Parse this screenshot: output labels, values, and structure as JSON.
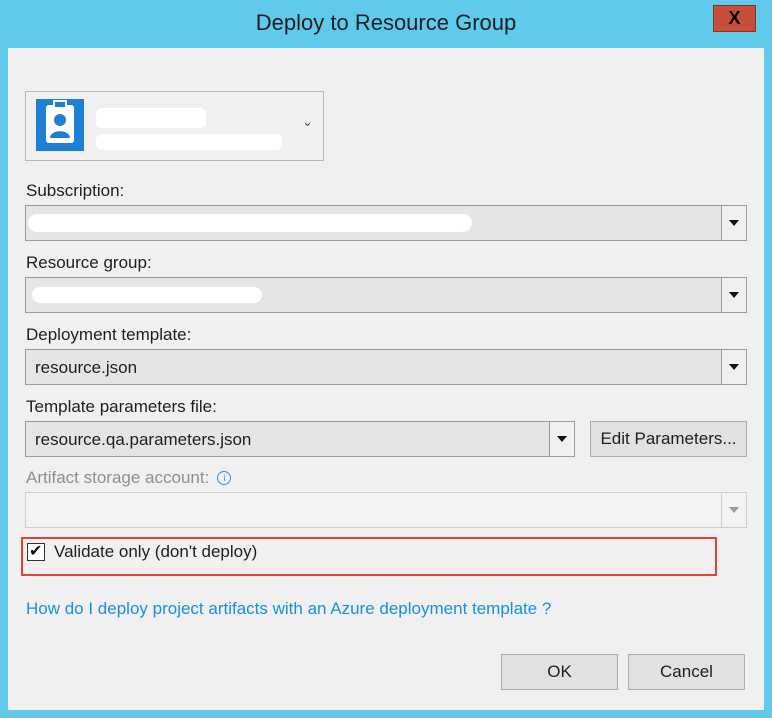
{
  "window": {
    "title": "Deploy to Resource Group",
    "close_glyph": "X"
  },
  "account": {
    "icon": "user-badge-icon"
  },
  "subscription": {
    "label": "Subscription:",
    "value": ""
  },
  "resource_group": {
    "label": "Resource group:",
    "value": ""
  },
  "deployment_template": {
    "label": "Deployment template:",
    "value": "resource.json"
  },
  "template_parameters": {
    "label": "Template parameters file:",
    "value": "resource.qa.parameters.json",
    "edit_button": "Edit Parameters..."
  },
  "artifact_storage": {
    "label": "Artifact storage account:",
    "info_glyph": "i",
    "value": ""
  },
  "validate_only": {
    "label": "Validate only (don't deploy)",
    "checked": true,
    "check_glyph": "✔"
  },
  "help_link": "How do I deploy project artifacts with an Azure deployment template ?",
  "buttons": {
    "ok": "OK",
    "cancel": "Cancel"
  },
  "colors": {
    "accent": "#5fcaec",
    "link": "#1a8fdf",
    "highlight": "#e0423a",
    "close": "#c74e3b"
  }
}
